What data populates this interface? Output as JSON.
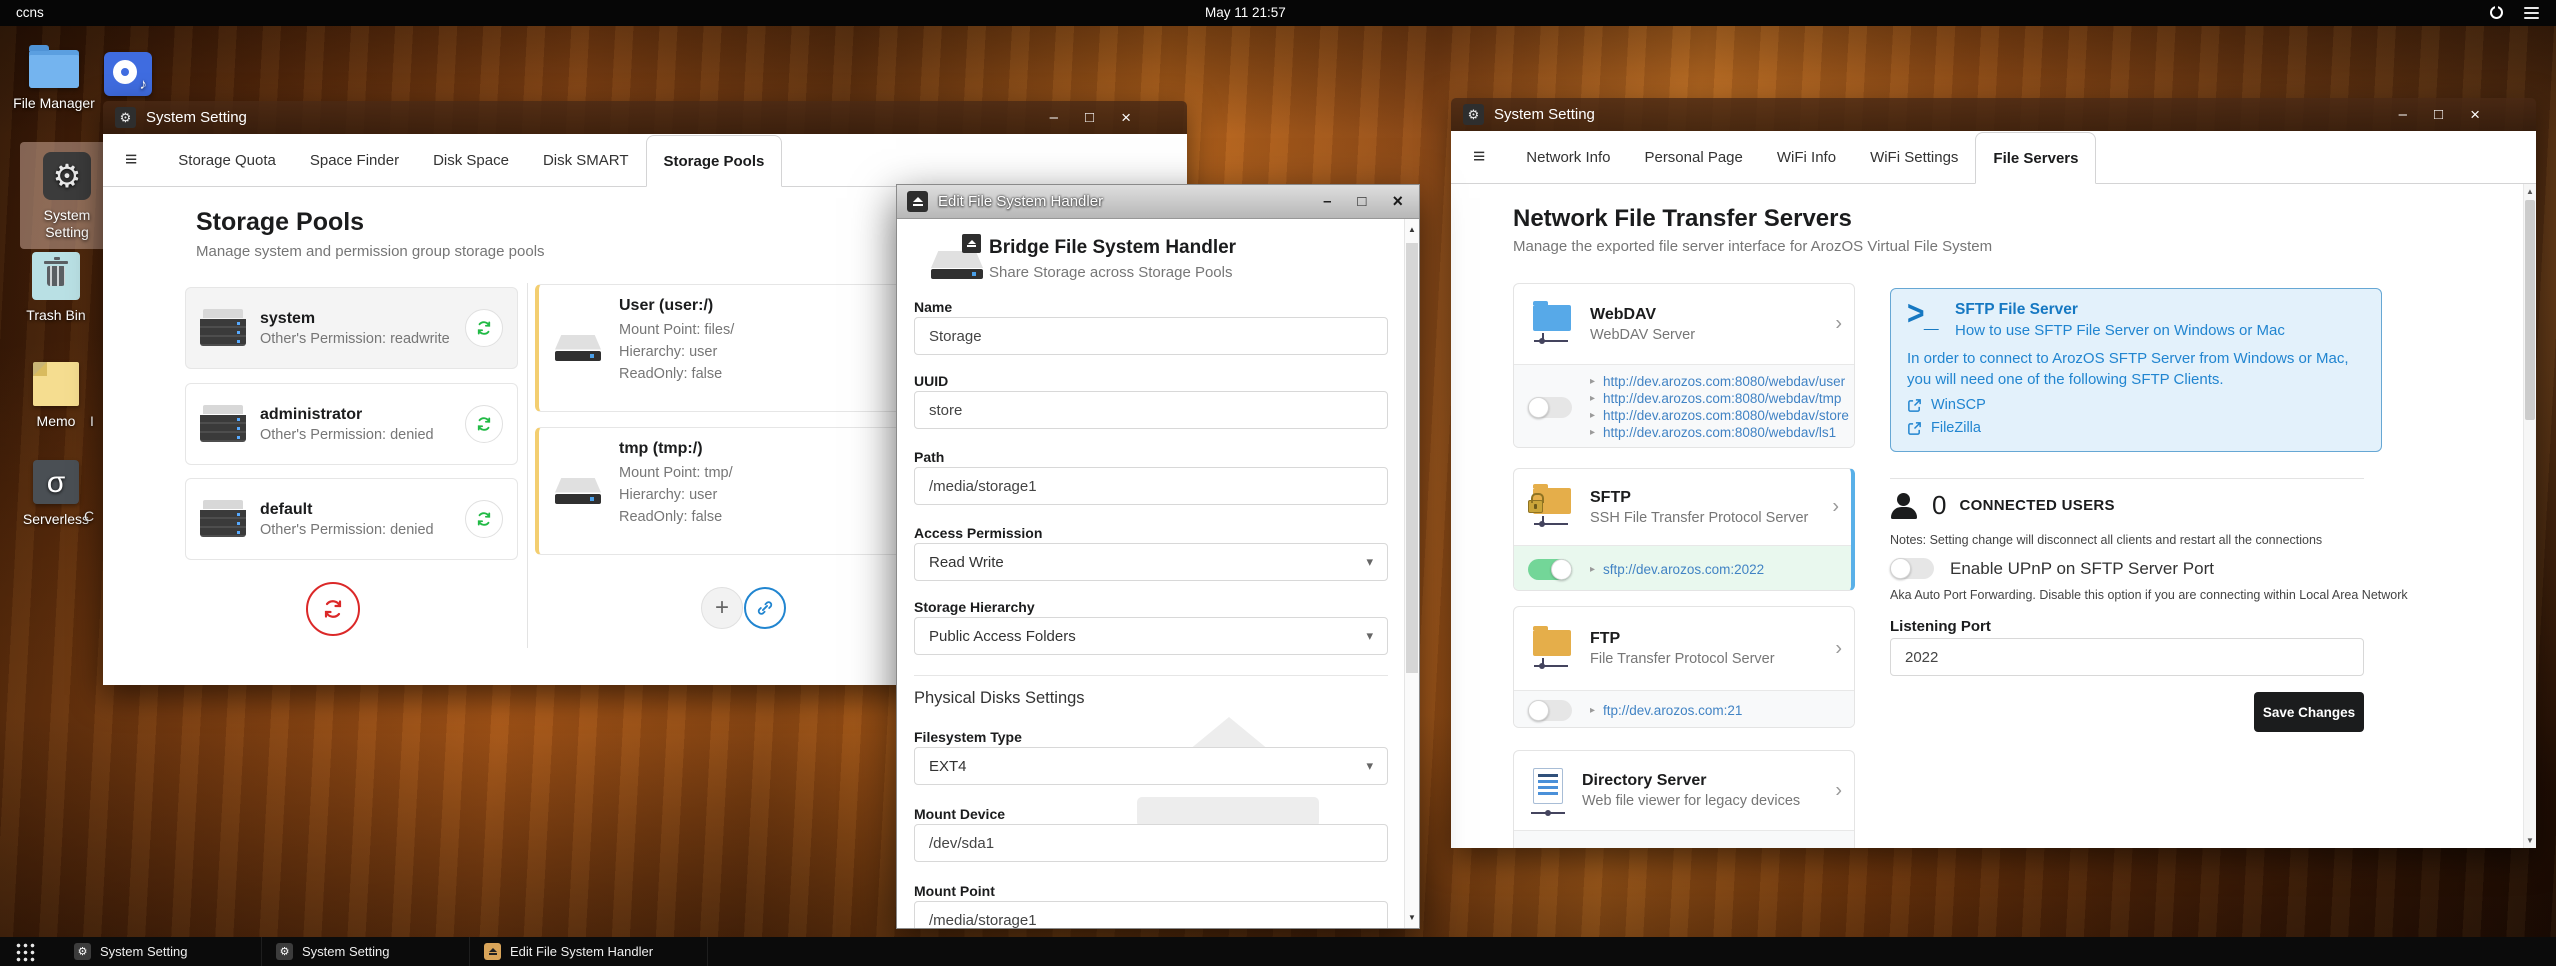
{
  "colors": {
    "accent_blue": "#2185d0",
    "link_blue": "#4183c4",
    "success_green": "#21ba45",
    "toggle_green": "#73d698",
    "alert_red": "#db2828",
    "handler_card_border": "#f3ce70",
    "selected_server_border": "#59b0e8",
    "dark_button": "#1b1c1d"
  },
  "icons": {
    "gear": "⚙",
    "hamburger": "≡",
    "chevron_right": "›",
    "caret_down": "▾",
    "bullet": "▸",
    "plus": "+",
    "minimize": "–",
    "maximize": "□",
    "close": "×",
    "music_note": "♪",
    "sigma": "σ",
    "scroll_up": "▲",
    "scroll_down": "▼",
    "terminal_gt": ">",
    "terminal_underscore": "_",
    "refresh": "circular-arrows-svg",
    "link": "chain-svg",
    "external_link": "arrow-out-box-svg",
    "person": "person-silhouette-shape",
    "eject": "eject-shape",
    "power": "power-ring-shape",
    "menu_grid": "grid-dots-shape"
  },
  "topbar": {
    "menu_label": "ccns",
    "clock": "May 11 21:57"
  },
  "desktop": {
    "icons": [
      {
        "label": "File Manager"
      },
      {
        "label": "System Setting"
      },
      {
        "label": "Trash Bin"
      },
      {
        "label": "Memo"
      },
      {
        "label": "Serverless"
      }
    ],
    "partial_labels": [
      "I",
      "C"
    ]
  },
  "storage_window": {
    "title": "System Setting",
    "tabs": [
      "Storage Quota",
      "Space Finder",
      "Disk Space",
      "Disk SMART",
      "Storage Pools"
    ],
    "active_tab": "Storage Pools",
    "heading": "Storage Pools",
    "subheading": "Manage system and permission group storage pools",
    "pools": [
      {
        "name": "system",
        "info": "Other's Permission: readwrite"
      },
      {
        "name": "administrator",
        "info": "Other's Permission: denied"
      },
      {
        "name": "default",
        "info": "Other's Permission: denied"
      }
    ],
    "handlers": [
      {
        "name": "User (user:/)",
        "mount": "Mount Point: files/",
        "hierarchy": "Hierarchy: user",
        "readonly": "ReadOnly: false"
      },
      {
        "name": "tmp (tmp:/)",
        "mount": "Mount Point: tmp/",
        "hierarchy": "Hierarchy: user",
        "readonly": "ReadOnly: false"
      }
    ]
  },
  "edit_window": {
    "title": "Edit File System Handler",
    "heading": "Bridge File System Handler",
    "subheading": "Share Storage across Storage Pools",
    "form": {
      "name_label": "Name",
      "name_value": "Storage",
      "uuid_label": "UUID",
      "uuid_value": "store",
      "path_label": "Path",
      "path_value": "/media/storage1",
      "access_label": "Access Permission",
      "access_value": "Read Write",
      "hierarchy_label": "Storage Hierarchy",
      "hierarchy_value": "Public Access Folders",
      "section": "Physical Disks Settings",
      "fstype_label": "Filesystem Type",
      "fstype_value": "EXT4",
      "mount_device_label": "Mount Device",
      "mount_device_value": "/dev/sda1",
      "mount_point_label": "Mount Point",
      "mount_point_value": "/media/storage1"
    }
  },
  "servers_window": {
    "title": "System Setting",
    "tabs": [
      "Network Info",
      "Personal Page",
      "WiFi Info",
      "WiFi Settings",
      "File Servers"
    ],
    "active_tab": "File Servers",
    "heading": "Network File Transfer Servers",
    "subheading": "Manage the exported file server interface for ArozOS Virtual File System",
    "webdav": {
      "name": "WebDAV",
      "desc": "WebDAV Server",
      "enabled": false,
      "links": [
        "http://dev.arozos.com:8080/webdav/user",
        "http://dev.arozos.com:8080/webdav/tmp",
        "http://dev.arozos.com:8080/webdav/store",
        "http://dev.arozos.com:8080/webdav/ls1"
      ]
    },
    "sftp": {
      "name": "SFTP",
      "desc": "SSH File Transfer Protocol Server",
      "enabled": true,
      "link": "sftp://dev.arozos.com:2022"
    },
    "ftp": {
      "name": "FTP",
      "desc": "File Transfer Protocol Server",
      "enabled": false,
      "link": "ftp://dev.arozos.com:21"
    },
    "dirserver": {
      "name": "Directory Server",
      "desc": "Web file viewer for legacy devices"
    },
    "detail": {
      "title": "SFTP File Server",
      "subtitle": "How to use SFTP File Server on Windows or Mac",
      "body": "In order to connect to ArozOS SFTP Server from Windows or Mac, you will need one of the following SFTP Clients.",
      "clients": [
        "WinSCP",
        "FileZilla"
      ],
      "connected_count": "0",
      "connected_label": "CONNECTED USERS",
      "notes": "Notes: Setting change will disconnect all clients and restart all the connections",
      "upnp_label": "Enable UPnP on SFTP Server Port",
      "upnp_desc": "Aka Auto Port Forwarding. Disable this option if you are connecting within Local Area Network",
      "port_label": "Listening Port",
      "port_value": "2022",
      "save_label": "Save Changes"
    }
  },
  "taskbar": {
    "items": [
      "System Setting",
      "System Setting",
      "Edit File System Handler"
    ]
  }
}
